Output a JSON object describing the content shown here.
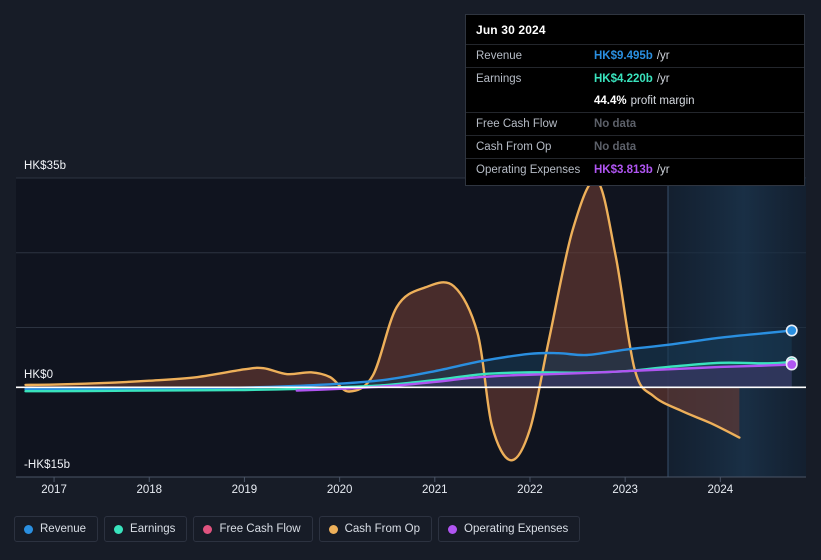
{
  "chart_data": {
    "type": "area",
    "title": "",
    "xlabel": "",
    "ylabel": "",
    "currency": "HK$",
    "xlim": [
      2016.6,
      2024.9
    ],
    "ylim": [
      -15,
      35
    ],
    "yticks": [
      35,
      0,
      -15
    ],
    "ytick_labels": [
      "HK$35b",
      "HK$0",
      "-HK$15b"
    ],
    "gridlines": [
      35,
      22.5,
      10,
      0,
      -15
    ],
    "grid": true,
    "legend_position": "bottom",
    "forecast_start": 2023.45,
    "xticks": [
      2017,
      2018,
      2019,
      2020,
      2021,
      2022,
      2023,
      2024
    ],
    "xtick_labels": [
      "2017",
      "2018",
      "2019",
      "2020",
      "2021",
      "2022",
      "2023",
      "2024"
    ],
    "series": [
      {
        "name": "Revenue",
        "color": "#2a8fe0",
        "fill": "#163852",
        "x": [
          2016.7,
          2017.0,
          2017.5,
          2018.0,
          2018.5,
          2019.0,
          2019.5,
          2020.0,
          2020.5,
          2021.0,
          2021.5,
          2022.0,
          2022.3,
          2022.6,
          2023.0,
          2023.45,
          2024.0,
          2024.5,
          2024.75
        ],
        "values": [
          -0.3,
          -0.3,
          -0.25,
          -0.2,
          -0.15,
          -0.05,
          0.2,
          0.6,
          1.3,
          2.7,
          4.4,
          5.6,
          5.7,
          5.4,
          6.3,
          7.1,
          8.3,
          9.1,
          9.495
        ],
        "end_value": 9.495
      },
      {
        "name": "Earnings",
        "color": "#39e3bd",
        "fill": "#1d5a56",
        "x": [
          2016.7,
          2017.0,
          2017.5,
          2018.0,
          2018.5,
          2019.0,
          2019.5,
          2020.0,
          2020.5,
          2021.0,
          2021.5,
          2022.0,
          2022.5,
          2023.0,
          2023.45,
          2024.0,
          2024.5,
          2024.75
        ],
        "values": [
          -0.65,
          -0.65,
          -0.6,
          -0.55,
          -0.5,
          -0.45,
          -0.3,
          0.0,
          0.4,
          1.2,
          2.2,
          2.5,
          2.45,
          2.7,
          3.4,
          4.1,
          4.0,
          4.22
        ],
        "end_value": 4.22
      },
      {
        "name": "Free Cash Flow",
        "color": "#e0537f",
        "fill": "#5a2436",
        "x": [],
        "values": [],
        "end_value": null,
        "no_data": true
      },
      {
        "name": "Cash From Op",
        "color": "#eeb05a",
        "fill": "#6b3b33",
        "x": [
          2016.7,
          2017.0,
          2017.5,
          2018.0,
          2018.5,
          2019.0,
          2019.2,
          2019.45,
          2019.7,
          2019.9,
          2020.1,
          2020.35,
          2020.6,
          2020.9,
          2021.2,
          2021.45,
          2021.6,
          2021.8,
          2022.0,
          2022.2,
          2022.45,
          2022.7,
          2022.9,
          2023.1,
          2023.3,
          2023.6,
          2023.9,
          2024.2
        ],
        "values": [
          0.4,
          0.45,
          0.7,
          1.1,
          1.7,
          3.0,
          3.2,
          2.2,
          2.5,
          1.7,
          -0.7,
          2.0,
          13.4,
          16.7,
          16.9,
          9.0,
          -6.4,
          -12.2,
          -7.0,
          8.0,
          26.4,
          34.6,
          22.0,
          3.0,
          -1.5,
          -4.0,
          -6.0,
          -8.4
        ],
        "end_value": null
      },
      {
        "name": "Operating Expenses",
        "color": "#b055f2",
        "fill": "#3d2a63",
        "x": [
          2019.55,
          2019.8,
          2020.2,
          2020.6,
          2021.0,
          2021.4,
          2021.8,
          2022.2,
          2022.6,
          2023.0,
          2023.45,
          2024.0,
          2024.5,
          2024.75
        ],
        "values": [
          -0.55,
          -0.4,
          -0.1,
          0.3,
          0.9,
          1.6,
          2.0,
          2.2,
          2.4,
          2.7,
          3.0,
          3.4,
          3.65,
          3.813
        ],
        "end_value": 3.813
      }
    ]
  },
  "tooltip": {
    "date": "Jun 30 2024",
    "rows": [
      {
        "label": "Revenue",
        "value": "HK$9.495b",
        "unit": "/yr",
        "color": "#2a8fe0",
        "no_data": false
      },
      {
        "label": "Earnings",
        "value": "HK$4.220b",
        "unit": "/yr",
        "color": "#39e3bd",
        "no_data": false
      },
      {
        "label": "",
        "value": "44.4%",
        "unit": "profit margin",
        "color": "#ffffff",
        "no_data": false
      },
      {
        "label": "Free Cash Flow",
        "value": "No data",
        "unit": "",
        "color": "#5c6069",
        "no_data": true
      },
      {
        "label": "Cash From Op",
        "value": "No data",
        "unit": "",
        "color": "#5c6069",
        "no_data": true
      },
      {
        "label": "Operating Expenses",
        "value": "HK$3.813b",
        "unit": "/yr",
        "color": "#b055f2",
        "no_data": false
      }
    ]
  },
  "legend": {
    "items": [
      {
        "label": "Revenue",
        "color": "#2a8fe0"
      },
      {
        "label": "Earnings",
        "color": "#39e3bd"
      },
      {
        "label": "Free Cash Flow",
        "color": "#e0537f"
      },
      {
        "label": "Cash From Op",
        "color": "#eeb05a"
      },
      {
        "label": "Operating Expenses",
        "color": "#b055f2"
      }
    ]
  },
  "colors": {
    "background": "#171c27",
    "plot_background": "#10141f",
    "forecast_background": "#16293d",
    "zero_line": "#ffffff",
    "grid": "#2c3340",
    "text": "#e8ecf3"
  }
}
